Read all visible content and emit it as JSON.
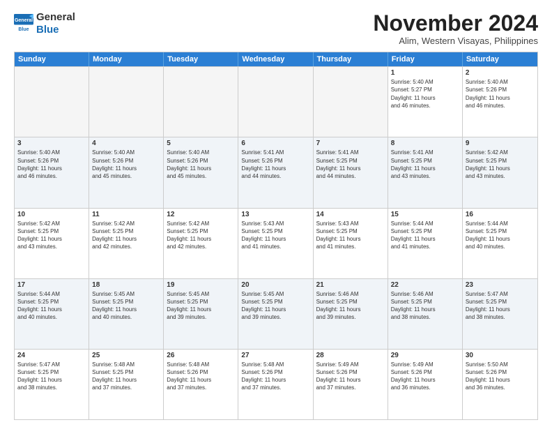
{
  "logo": {
    "general": "General",
    "blue": "Blue"
  },
  "title": "November 2024",
  "location": "Alim, Western Visayas, Philippines",
  "header_days": [
    "Sunday",
    "Monday",
    "Tuesday",
    "Wednesday",
    "Thursday",
    "Friday",
    "Saturday"
  ],
  "weeks": [
    [
      {
        "day": "",
        "info": ""
      },
      {
        "day": "",
        "info": ""
      },
      {
        "day": "",
        "info": ""
      },
      {
        "day": "",
        "info": ""
      },
      {
        "day": "",
        "info": ""
      },
      {
        "day": "1",
        "info": "Sunrise: 5:40 AM\nSunset: 5:27 PM\nDaylight: 11 hours\nand 46 minutes."
      },
      {
        "day": "2",
        "info": "Sunrise: 5:40 AM\nSunset: 5:26 PM\nDaylight: 11 hours\nand 46 minutes."
      }
    ],
    [
      {
        "day": "3",
        "info": "Sunrise: 5:40 AM\nSunset: 5:26 PM\nDaylight: 11 hours\nand 46 minutes."
      },
      {
        "day": "4",
        "info": "Sunrise: 5:40 AM\nSunset: 5:26 PM\nDaylight: 11 hours\nand 45 minutes."
      },
      {
        "day": "5",
        "info": "Sunrise: 5:40 AM\nSunset: 5:26 PM\nDaylight: 11 hours\nand 45 minutes."
      },
      {
        "day": "6",
        "info": "Sunrise: 5:41 AM\nSunset: 5:26 PM\nDaylight: 11 hours\nand 44 minutes."
      },
      {
        "day": "7",
        "info": "Sunrise: 5:41 AM\nSunset: 5:25 PM\nDaylight: 11 hours\nand 44 minutes."
      },
      {
        "day": "8",
        "info": "Sunrise: 5:41 AM\nSunset: 5:25 PM\nDaylight: 11 hours\nand 43 minutes."
      },
      {
        "day": "9",
        "info": "Sunrise: 5:42 AM\nSunset: 5:25 PM\nDaylight: 11 hours\nand 43 minutes."
      }
    ],
    [
      {
        "day": "10",
        "info": "Sunrise: 5:42 AM\nSunset: 5:25 PM\nDaylight: 11 hours\nand 43 minutes."
      },
      {
        "day": "11",
        "info": "Sunrise: 5:42 AM\nSunset: 5:25 PM\nDaylight: 11 hours\nand 42 minutes."
      },
      {
        "day": "12",
        "info": "Sunrise: 5:42 AM\nSunset: 5:25 PM\nDaylight: 11 hours\nand 42 minutes."
      },
      {
        "day": "13",
        "info": "Sunrise: 5:43 AM\nSunset: 5:25 PM\nDaylight: 11 hours\nand 41 minutes."
      },
      {
        "day": "14",
        "info": "Sunrise: 5:43 AM\nSunset: 5:25 PM\nDaylight: 11 hours\nand 41 minutes."
      },
      {
        "day": "15",
        "info": "Sunrise: 5:44 AM\nSunset: 5:25 PM\nDaylight: 11 hours\nand 41 minutes."
      },
      {
        "day": "16",
        "info": "Sunrise: 5:44 AM\nSunset: 5:25 PM\nDaylight: 11 hours\nand 40 minutes."
      }
    ],
    [
      {
        "day": "17",
        "info": "Sunrise: 5:44 AM\nSunset: 5:25 PM\nDaylight: 11 hours\nand 40 minutes."
      },
      {
        "day": "18",
        "info": "Sunrise: 5:45 AM\nSunset: 5:25 PM\nDaylight: 11 hours\nand 40 minutes."
      },
      {
        "day": "19",
        "info": "Sunrise: 5:45 AM\nSunset: 5:25 PM\nDaylight: 11 hours\nand 39 minutes."
      },
      {
        "day": "20",
        "info": "Sunrise: 5:45 AM\nSunset: 5:25 PM\nDaylight: 11 hours\nand 39 minutes."
      },
      {
        "day": "21",
        "info": "Sunrise: 5:46 AM\nSunset: 5:25 PM\nDaylight: 11 hours\nand 39 minutes."
      },
      {
        "day": "22",
        "info": "Sunrise: 5:46 AM\nSunset: 5:25 PM\nDaylight: 11 hours\nand 38 minutes."
      },
      {
        "day": "23",
        "info": "Sunrise: 5:47 AM\nSunset: 5:25 PM\nDaylight: 11 hours\nand 38 minutes."
      }
    ],
    [
      {
        "day": "24",
        "info": "Sunrise: 5:47 AM\nSunset: 5:25 PM\nDaylight: 11 hours\nand 38 minutes."
      },
      {
        "day": "25",
        "info": "Sunrise: 5:48 AM\nSunset: 5:25 PM\nDaylight: 11 hours\nand 37 minutes."
      },
      {
        "day": "26",
        "info": "Sunrise: 5:48 AM\nSunset: 5:26 PM\nDaylight: 11 hours\nand 37 minutes."
      },
      {
        "day": "27",
        "info": "Sunrise: 5:48 AM\nSunset: 5:26 PM\nDaylight: 11 hours\nand 37 minutes."
      },
      {
        "day": "28",
        "info": "Sunrise: 5:49 AM\nSunset: 5:26 PM\nDaylight: 11 hours\nand 37 minutes."
      },
      {
        "day": "29",
        "info": "Sunrise: 5:49 AM\nSunset: 5:26 PM\nDaylight: 11 hours\nand 36 minutes."
      },
      {
        "day": "30",
        "info": "Sunrise: 5:50 AM\nSunset: 5:26 PM\nDaylight: 11 hours\nand 36 minutes."
      }
    ]
  ]
}
